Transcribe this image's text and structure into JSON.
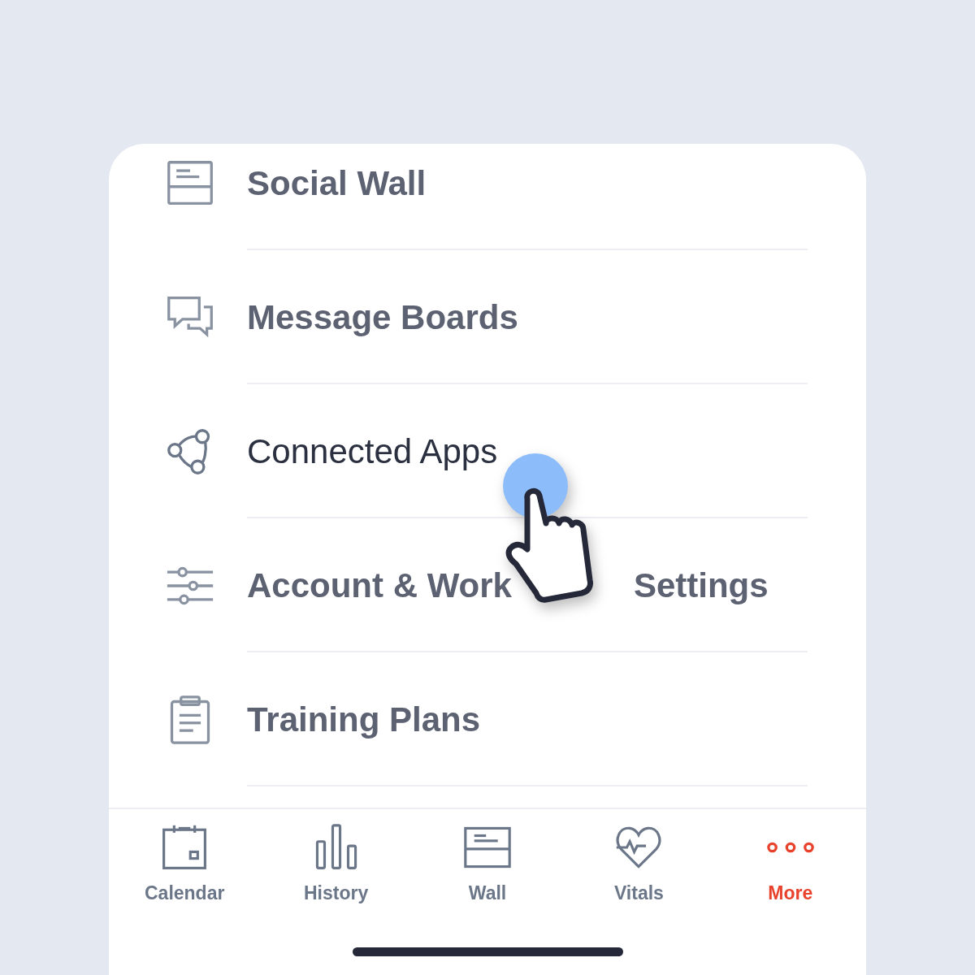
{
  "menu": [
    {
      "kind": "wall",
      "label": "Social Wall",
      "focused": false
    },
    {
      "kind": "chat",
      "label": "Message Boards",
      "focused": false
    },
    {
      "kind": "connect",
      "label": "Connected Apps",
      "focused": true
    },
    {
      "kind": "sliders",
      "label": "Account & Work",
      "label_after": "Settings",
      "focused": false
    },
    {
      "kind": "clipboard",
      "label": "Training Plans",
      "focused": false
    }
  ],
  "tabs": [
    {
      "kind": "calendar",
      "label": "Calendar",
      "selected": false
    },
    {
      "kind": "history",
      "label": "History",
      "selected": false
    },
    {
      "kind": "wall",
      "label": "Wall",
      "selected": false
    },
    {
      "kind": "vitals",
      "label": "Vitals",
      "selected": false
    },
    {
      "kind": "more",
      "label": "More",
      "selected": true
    }
  ]
}
